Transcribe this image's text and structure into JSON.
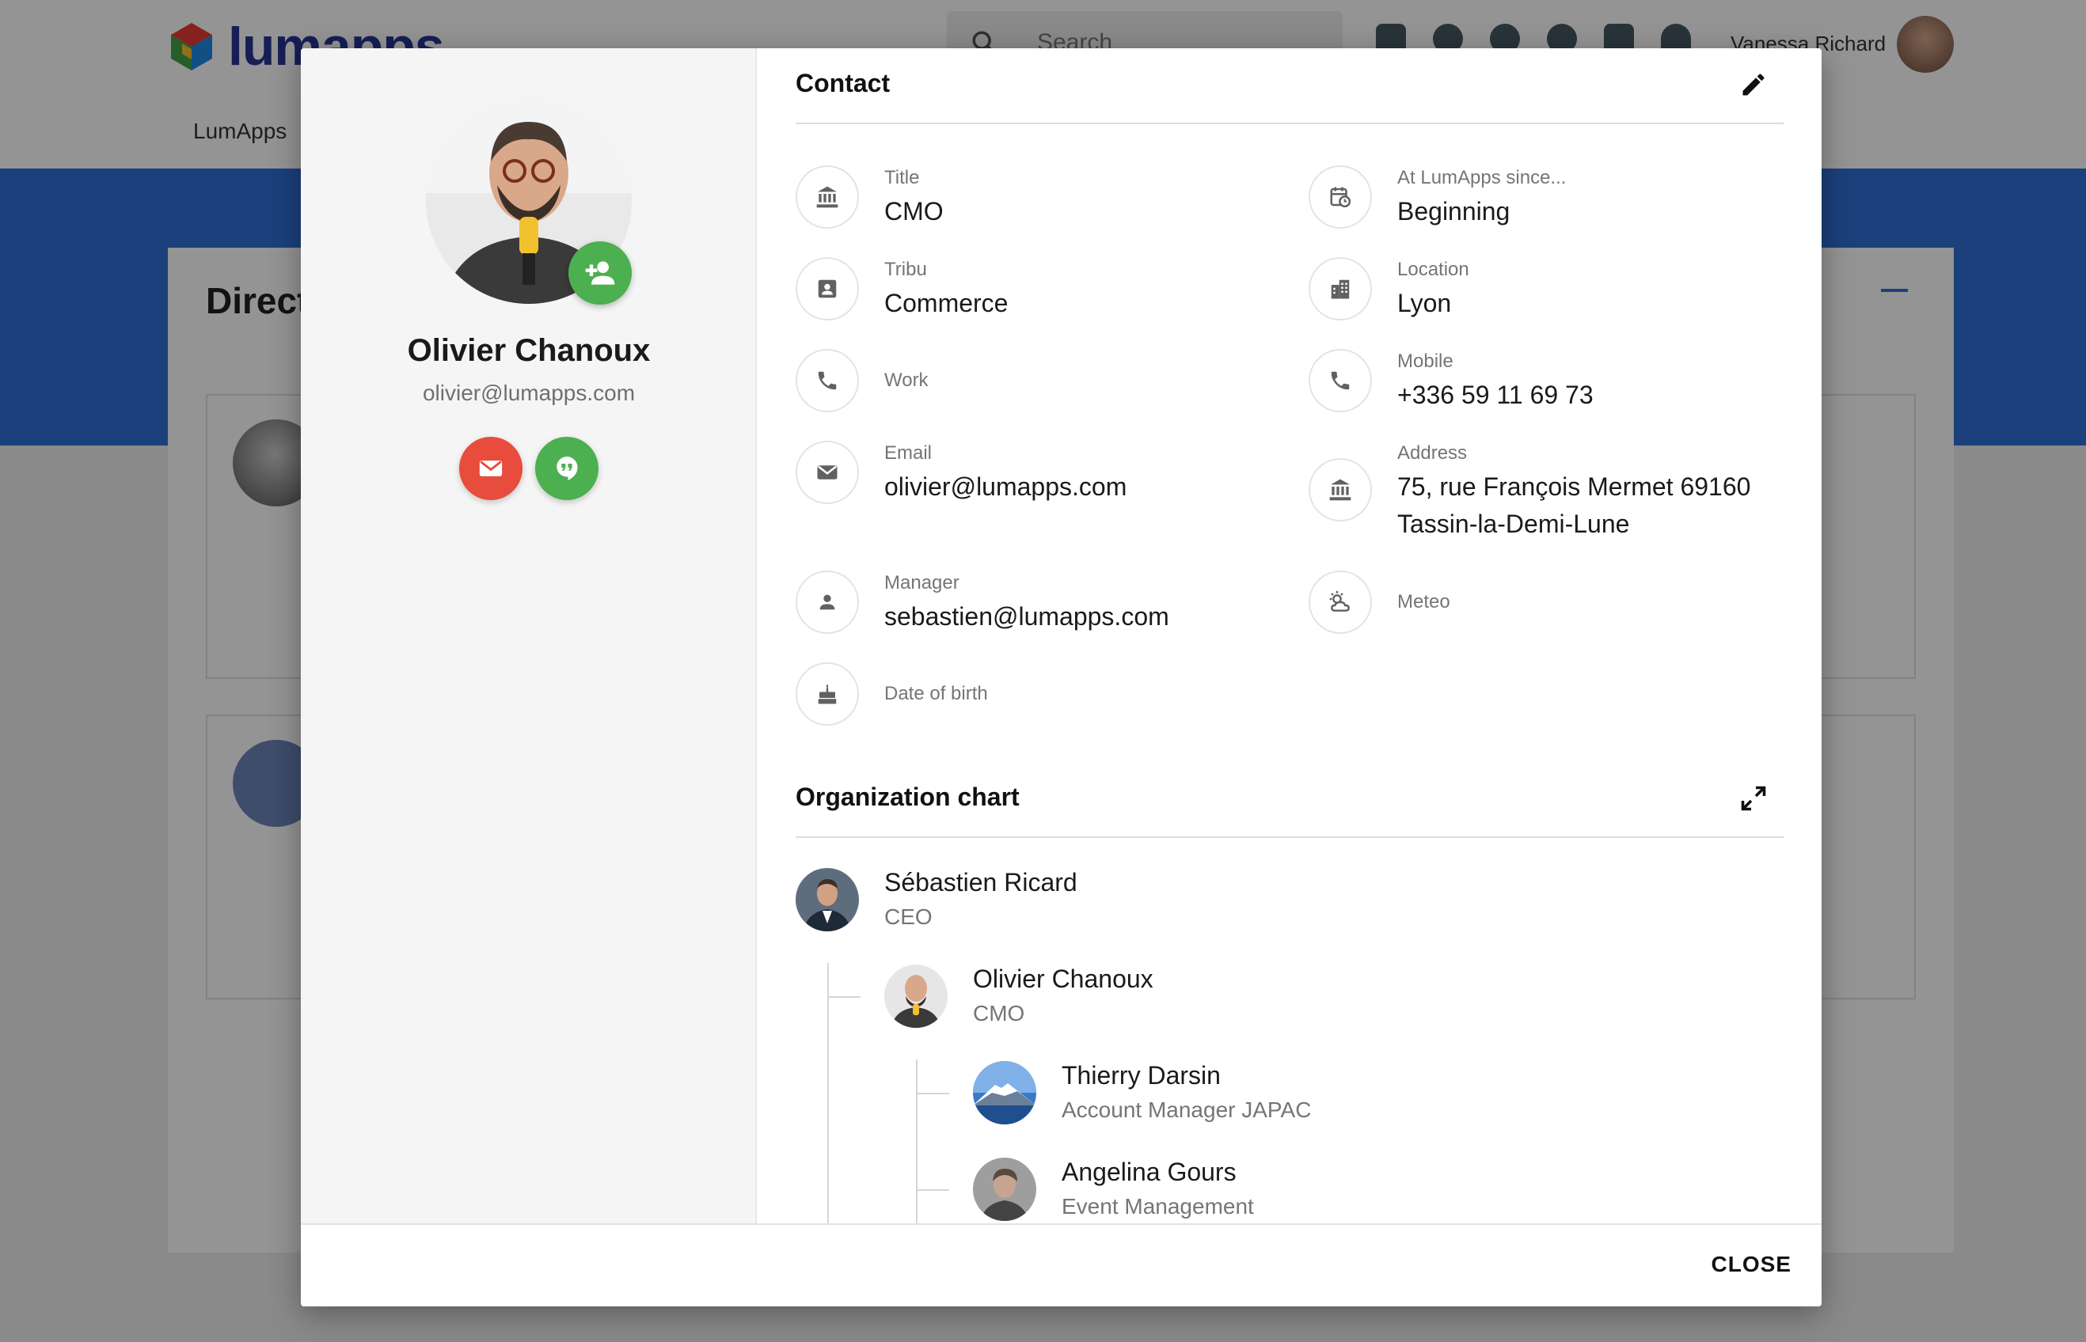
{
  "background": {
    "logo_text": "lumapps",
    "search_placeholder": "Search",
    "user_name": "Vanessa Richard",
    "nav_label": "LumApps",
    "card_title": "Direct"
  },
  "profile": {
    "name": "Olivier Chanoux",
    "email": "olivier@lumapps.com"
  },
  "contact": {
    "title": "Contact",
    "left_fields": [
      {
        "label": "Title",
        "value": "CMO",
        "icon": "bank-icon"
      },
      {
        "label": "Tribu",
        "value": "Commerce",
        "icon": "badge-icon"
      },
      {
        "label": "Work",
        "value": "",
        "icon": "phone-icon"
      },
      {
        "label": "Email",
        "value": "olivier@lumapps.com",
        "icon": "mail-icon"
      },
      {
        "label": "Manager",
        "value": "sebastien@lumapps.com",
        "icon": "person-icon"
      },
      {
        "label": "Date of birth",
        "value": "",
        "icon": "cake-icon"
      }
    ],
    "right_fields": [
      {
        "label": "At LumApps since...",
        "value": "Beginning",
        "icon": "calendar-clock-icon"
      },
      {
        "label": "Location",
        "value": "Lyon",
        "icon": "city-icon"
      },
      {
        "label": "Mobile",
        "value": "+336 59 11 69 73",
        "icon": "phone-icon"
      },
      {
        "label": "Address",
        "value": "75, rue François Mermet 69160",
        "value2": "Tassin-la-Demi-Lune",
        "icon": "bank-icon"
      },
      {
        "label": "Meteo",
        "value": "",
        "icon": "weather-icon"
      }
    ]
  },
  "org_chart": {
    "title": "Organization chart",
    "nodes": [
      {
        "name": "Sébastien Ricard",
        "role": "CEO"
      },
      {
        "name": "Olivier Chanoux",
        "role": "CMO"
      },
      {
        "name": "Thierry Darsin",
        "role": "Account Manager JAPAC"
      },
      {
        "name": "Angelina Gours",
        "role": "Event Management"
      }
    ]
  },
  "footer": {
    "close_label": "CLOSE"
  },
  "colors": {
    "accent_green": "#4caf50",
    "accent_red": "#e74c3c",
    "banner_blue": "#2f6fd6"
  }
}
